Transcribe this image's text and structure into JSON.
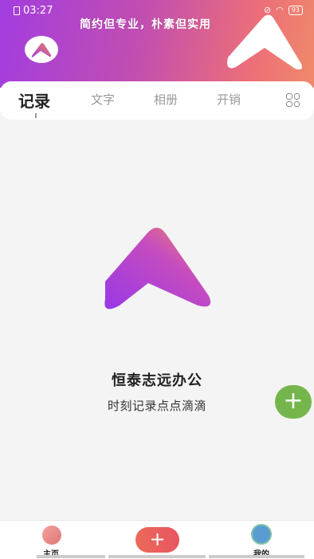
{
  "status": {
    "time": "03:27",
    "battery": "93"
  },
  "header": {
    "slogan": "简约但专业，朴素但实用"
  },
  "tabs": [
    {
      "label": "记录",
      "active": true
    },
    {
      "label": "文字",
      "active": false
    },
    {
      "label": "相册",
      "active": false
    },
    {
      "label": "开销",
      "active": false
    }
  ],
  "empty_state": {
    "title": "恒泰志远办公",
    "subtitle": "时刻记录点点滴滴"
  },
  "fab": {
    "label": "+"
  },
  "bottom_nav": {
    "home": "主页",
    "add": "+",
    "me": "我的"
  }
}
